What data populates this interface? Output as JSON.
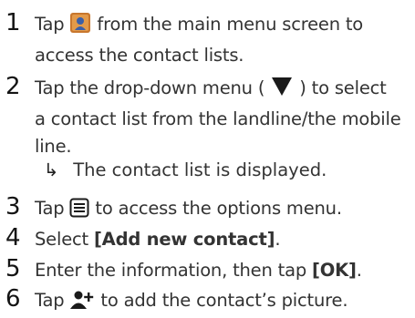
{
  "steps": [
    {
      "number": "1",
      "pre": "Tap",
      "post": "from the main menu screen to",
      "line2": "access the contact lists.",
      "icon": "phonebook-app-icon"
    },
    {
      "number": "2",
      "pre": "Tap the drop-down menu (",
      "post": ") to select",
      "line2": "a contact list from the landline/the mobile",
      "line3": "line.",
      "icon": "dropdown-triangle-icon"
    },
    {
      "number": "3",
      "pre": "Tap",
      "post": "to access the options menu.",
      "icon": "menu-options-icon"
    },
    {
      "number": "4",
      "pre": "Select",
      "bold": "[Add new contact]",
      "post": "."
    },
    {
      "number": "5",
      "pre": "Enter the information, then tap",
      "bold": "[OK]",
      "post": "."
    },
    {
      "number": "6",
      "pre": "Tap",
      "post": "to add the contact’s picture.",
      "icon": "add-contact-picture-icon"
    }
  ],
  "result_note": {
    "arrow": "↳",
    "text": "The contact list is displayed."
  },
  "colors": {
    "text": "#333333",
    "number": "#141414",
    "icon_dark": "#1a1a1a",
    "app_icon_orange": "#c8772e",
    "app_icon_blue": "#3b5fa8"
  }
}
